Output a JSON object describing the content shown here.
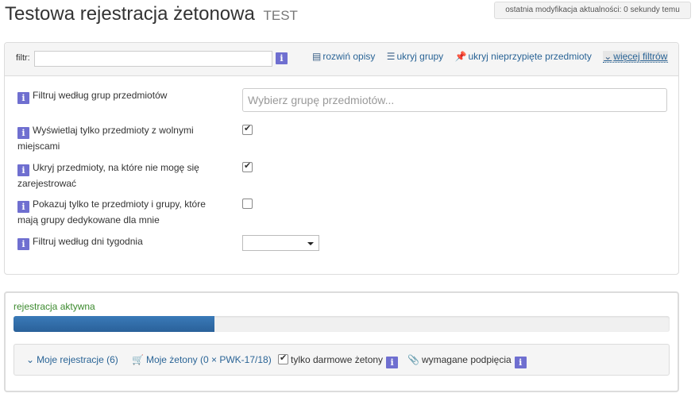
{
  "header": {
    "title": "Testowa rejestracja żetonowa",
    "title_suffix": "TEST",
    "last_modified": "ostatnia modyfikacja aktualności: 0 sekundy temu"
  },
  "filter_bar": {
    "label": "filtr:",
    "input_value": "",
    "info_icon": "i",
    "links": {
      "expand_descriptions": "rozwiń opisy",
      "hide_groups": "ukryj grupy",
      "hide_unpinned": "ukryj nieprzypięte przedmioty",
      "more_filters": "więcej filtrów"
    },
    "icons": {
      "expand_descriptions": "list-icon",
      "hide_groups": "menu-lines-icon",
      "hide_unpinned": "pin-icon",
      "more_filters": "chevron-down-icon"
    }
  },
  "filters": {
    "group_filter_label": "Filtruj według grup przedmiotów",
    "group_filter_placeholder": "Wybierz grupę przedmiotów...",
    "free_places_label": "Wyświetlaj tylko przedmioty z wolnymi miejscami",
    "free_places_checked": true,
    "hide_unregisterable_label": "Ukryj przedmioty, na które nie mogę się zarejestrować",
    "hide_unregisterable_checked": true,
    "dedicated_groups_label": "Pokazuj tylko te przedmioty i grupy, które mają grupy dedykowane dla mnie",
    "dedicated_groups_checked": false,
    "weekday_filter_label": "Filtruj według dni tygodnia",
    "weekday_value": ""
  },
  "registration": {
    "status": "rejestracja aktywna",
    "status_color": "#3c8a2e",
    "progress_fraction": 0.306,
    "progress_color": "#2a619a",
    "my_registrations": "Moje rejestracje (6)",
    "my_tokens": "Moje żetony (0 × PWK-17/18)",
    "free_tokens_only": "tylko darmowe żetony",
    "free_tokens_only_checked": true,
    "required_attachments": "wymagane podpięcia"
  },
  "colors": {
    "link": "#2a6496",
    "info_icon_bg": "#6f6fd0"
  }
}
